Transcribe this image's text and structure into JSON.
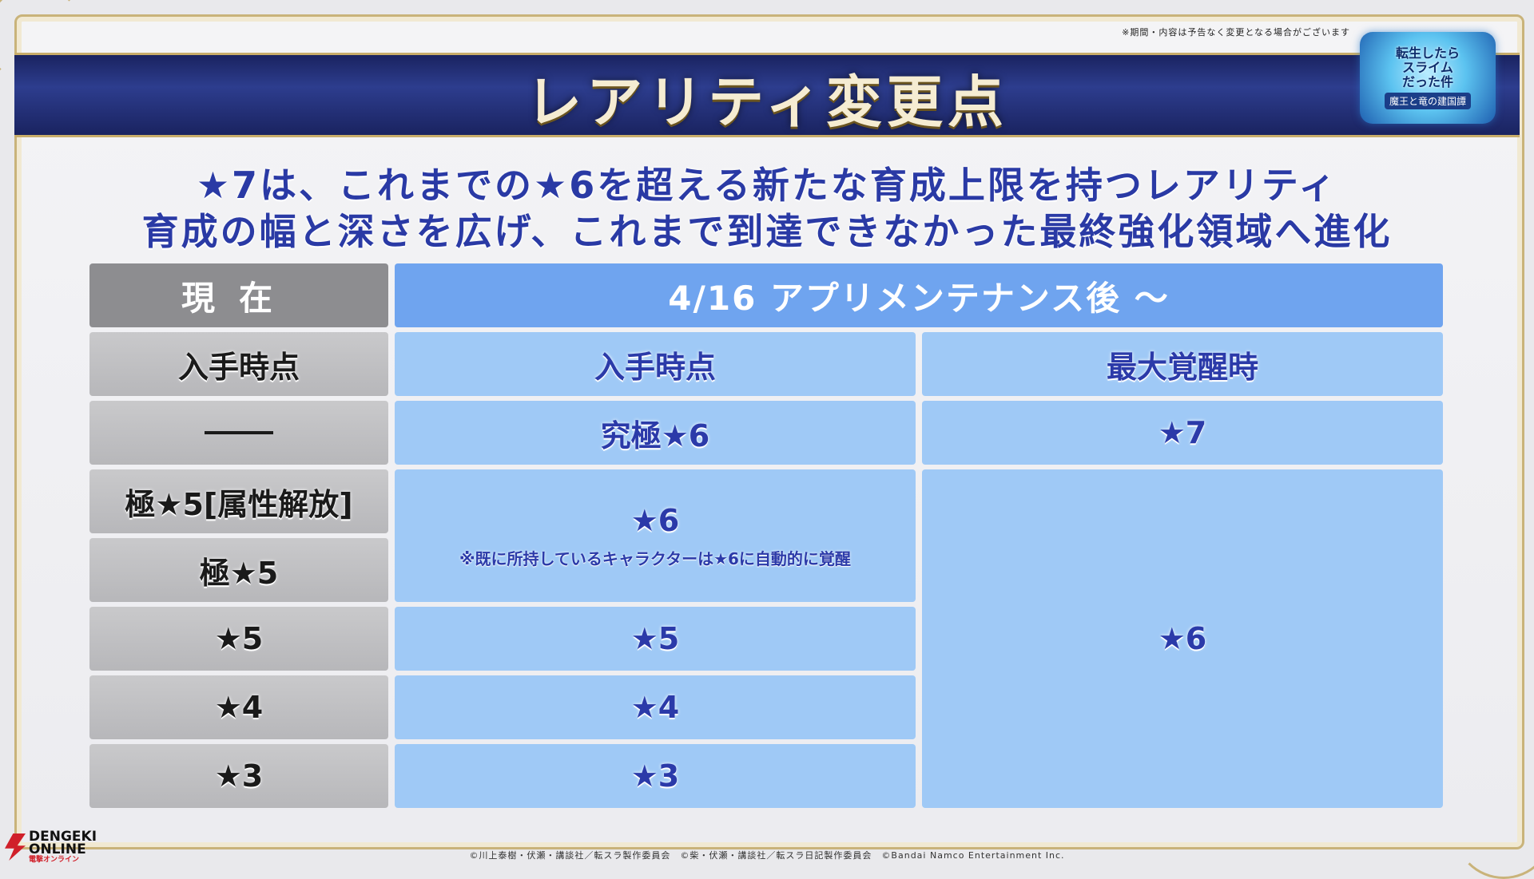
{
  "notice": "※期間・内容は予告なく変更となる場合がございます",
  "title": "レアリティ変更点",
  "logo": {
    "line1": "転生したら",
    "line2": "スライム",
    "line3": "だった件",
    "subtitle": "魔王と竜の建国譚"
  },
  "headline": {
    "line1": "★7は、これまでの★6を超える新たな育成上限を持つレアリティ",
    "line2": "育成の幅と深さを広げ、これまで到達できなかった最終強化領域へ進化"
  },
  "table": {
    "current_header": "現在",
    "after_header": "4/16 アプリメンテナンス後 ～",
    "current_col": [
      "入手時点",
      "―",
      "極★5[属性解放]",
      "極★5",
      "★5",
      "★4",
      "★3"
    ],
    "after_obtain_col": [
      "入手時点",
      "究極★6",
      "★6",
      "★5",
      "★4",
      "★3"
    ],
    "after_obtain_note": "※既に所持しているキャラクターは★6に自動的に覚醒",
    "after_max_col": [
      "最大覚醒時",
      "★7",
      "★6"
    ]
  },
  "copyright": "©川上泰樹・伏瀬・講談社／転スラ製作委員会　©柴・伏瀬・講談社／転スラ日記製作委員会　©Bandai Namco Entertainment Inc.",
  "watermark": {
    "line1": "DENGEKI",
    "line2": "ONLINE",
    "line3": "電撃オンライン"
  }
}
